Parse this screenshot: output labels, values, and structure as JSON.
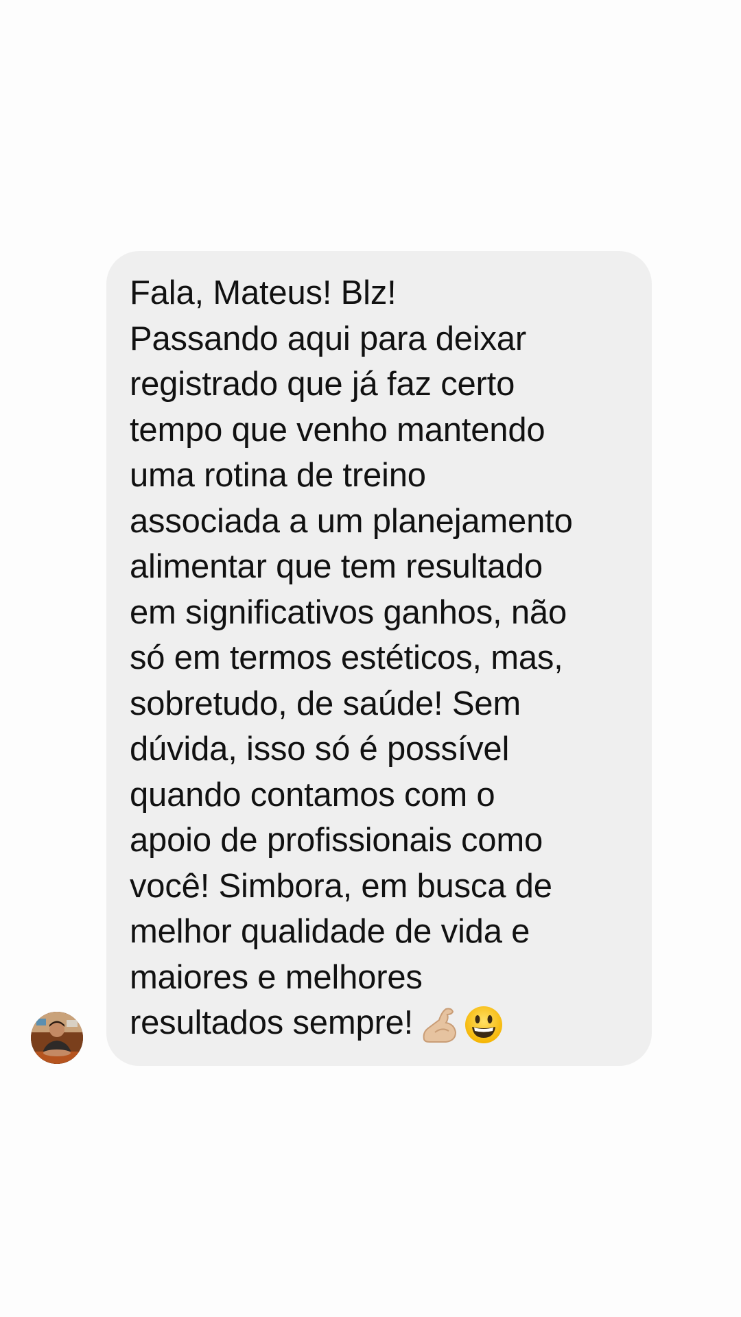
{
  "conversation": {
    "sender_avatar_icon": "user-avatar-photo",
    "message": {
      "lines": [
        "Fala, Mateus! Blz!",
        "Passando aqui para deixar",
        "registrado que já faz certo",
        "tempo que venho mantendo",
        "uma rotina de treino",
        "associada a um planejamento",
        "alimentar que tem resultado",
        "em significativos ganhos, não",
        "só em termos estéticos, mas,",
        "sobretudo, de saúde! Sem",
        "dúvida, isso só é possível",
        "quando contamos com o",
        "apoio de profissionais como",
        "você! Simbora, em busca de",
        "melhor qualidade de vida e",
        "maiores e melhores",
        "resultados sempre!"
      ],
      "emojis": [
        "flexed-biceps-icon",
        "grinning-face-icon"
      ]
    }
  },
  "colors": {
    "background": "#fdfdfd",
    "bubble": "#efefef",
    "text": "#111111"
  }
}
